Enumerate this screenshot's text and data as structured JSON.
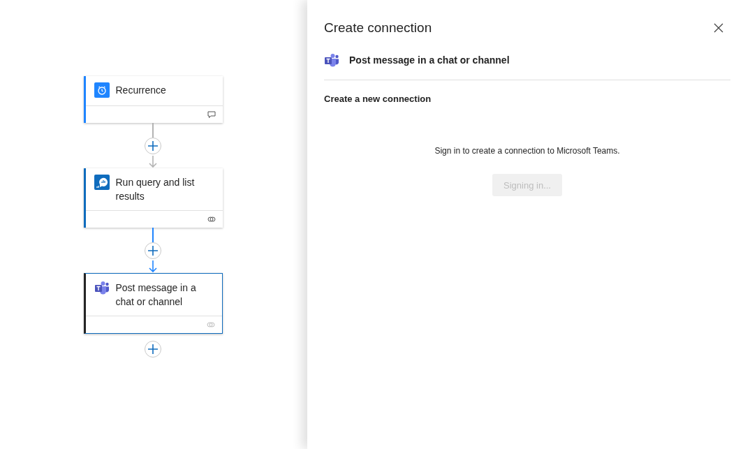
{
  "canvas": {
    "nodes": [
      {
        "kind": "recurrence",
        "title": "Recurrence",
        "color": "#1f85ff",
        "selected": false,
        "footer": {
          "kind": "comment",
          "faded": false
        }
      },
      {
        "kind": "query",
        "title": "Run query and list results",
        "color": "#0f6cbd",
        "selected": false,
        "footer": {
          "kind": "link",
          "faded": false
        }
      },
      {
        "kind": "teams",
        "title": "Post message in a chat or channel",
        "color": "#242424",
        "selected": true,
        "footer": {
          "kind": "link",
          "faded": true
        }
      }
    ],
    "connectors": [
      {
        "highlighted": false
      },
      {
        "highlighted": true
      }
    ]
  },
  "panel": {
    "title": "Create connection",
    "action": {
      "kind": "teams",
      "label": "Post message in a chat or channel"
    },
    "section_heading": "Create a new connection",
    "message": "Sign in to create a connection to Microsoft Teams.",
    "button": {
      "label": "Signing in...",
      "disabled": true
    }
  }
}
